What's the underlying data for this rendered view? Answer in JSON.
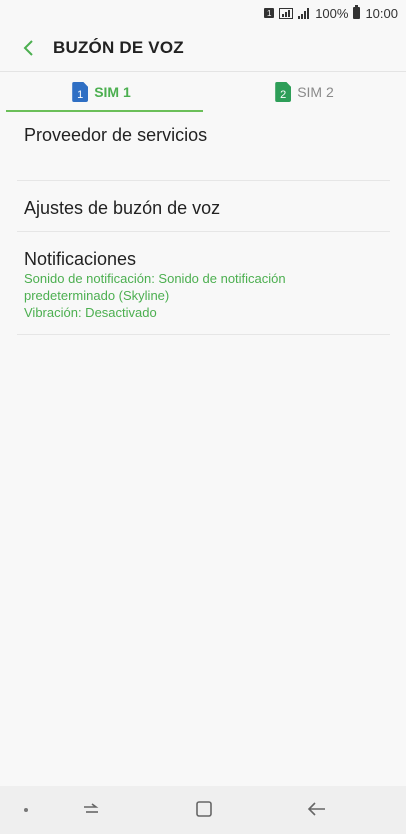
{
  "status_bar": {
    "sim_indicator": "1",
    "battery_percent": "100%",
    "time": "10:00",
    "icons": [
      "sim-1-icon",
      "signal-icon",
      "signal-bars-icon",
      "battery-icon"
    ]
  },
  "header": {
    "title": "BUZÓN DE VOZ",
    "back_icon": "chevron-left-icon"
  },
  "tabs": [
    {
      "label": "SIM 1",
      "badge": "1",
      "active": true
    },
    {
      "label": "SIM 2",
      "badge": "2",
      "active": false
    }
  ],
  "settings": {
    "service_provider": "Proveedor de servicios",
    "voicemail_settings": "Ajustes de buzón de voz",
    "notifications": {
      "title": "Notificaciones",
      "sound_line1": "Sonido de notificación: Sonido de notificación",
      "sound_line2": "predeterminado (Skyline)",
      "vibration": "Vibración: Desactivado"
    }
  },
  "nav_bar": {
    "icons": [
      "dot-icon",
      "recents-icon",
      "home-icon",
      "back-icon"
    ]
  },
  "colors": {
    "accent": "#4caf50",
    "sim1": "#2f6fc4",
    "sim2": "#2e9e58"
  }
}
